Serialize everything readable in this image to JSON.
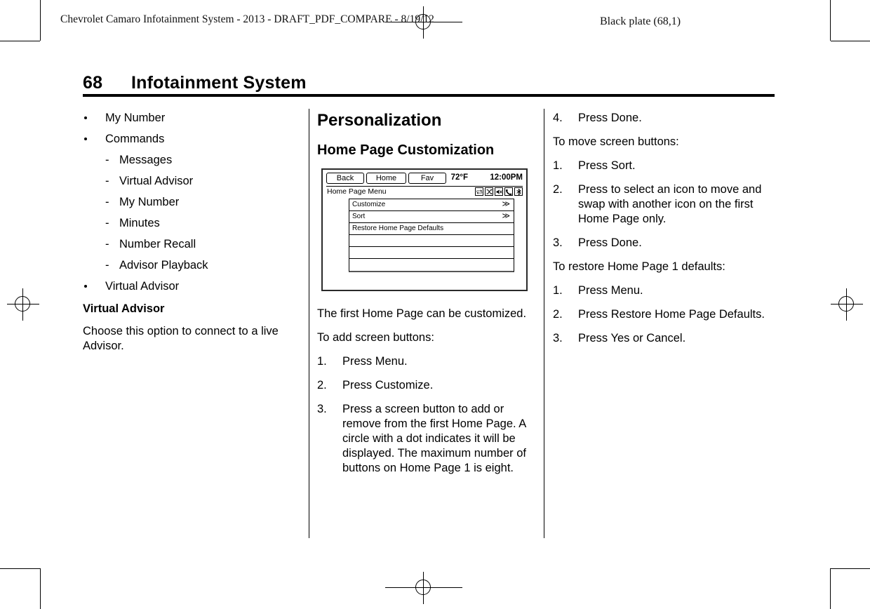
{
  "running_head": {
    "left": "Chevrolet Camaro Infotainment System - 2013 - DRAFT_PDF_COMPARE - 8/19/12",
    "right": "Black plate (68,1)"
  },
  "page_title": {
    "number": "68",
    "text": "Infotainment System"
  },
  "left_column": {
    "bullets": [
      {
        "label": "My Number",
        "sub": []
      },
      {
        "label": "Commands",
        "sub": [
          "Messages",
          "Virtual Advisor",
          "My Number",
          "Minutes",
          "Number Recall",
          "Advisor Playback"
        ]
      },
      {
        "label": "Virtual Advisor",
        "sub": []
      }
    ],
    "heading": "Virtual Advisor",
    "paragraph": "Choose this option to connect to a live Advisor."
  },
  "middle_column": {
    "section_heading": "Personalization",
    "sub_heading": "Home Page Customization",
    "screen": {
      "buttons": [
        {
          "label": "Back"
        },
        {
          "label": "Home"
        },
        {
          "label": "Fav"
        }
      ],
      "temperature": "72°F",
      "time": "12:00PM",
      "menu_title": "Home Page Menu",
      "status_icons": [
        "repeat-icon",
        "shuffle-icon",
        "mute-speaker-icon",
        "phone-icon",
        "bluetooth-icon"
      ],
      "rows": [
        {
          "label": "Customize",
          "arrow": "≫"
        },
        {
          "label": "Sort",
          "arrow": "≫"
        },
        {
          "label": "Restore Home Page Defaults",
          "arrow": ""
        },
        {
          "label": "",
          "arrow": ""
        },
        {
          "label": "",
          "arrow": ""
        },
        {
          "label": "",
          "arrow": ""
        }
      ]
    },
    "paragraph_1": "The first Home Page can be customized.",
    "paragraph_2": "To add screen buttons:",
    "steps": [
      {
        "num": "1.",
        "text": "Press Menu."
      },
      {
        "num": "2.",
        "text": "Press Customize."
      },
      {
        "num": "3.",
        "text": "Press a screen button to add or remove from the first Home Page. A circle with a dot indicates it will be displayed. The maximum number of buttons on Home Page 1 is eight."
      }
    ]
  },
  "right_column": {
    "steps_continued": [
      {
        "num": "4.",
        "text": "Press Done."
      }
    ],
    "move_intro": "To move screen buttons:",
    "move_steps": [
      {
        "num": "1.",
        "text": "Press Sort."
      },
      {
        "num": "2.",
        "text": "Press to select an icon to move and swap with another icon on the first Home Page only."
      },
      {
        "num": "3.",
        "text": "Press Done."
      }
    ],
    "restore_intro": "To restore Home Page 1 defaults:",
    "restore_steps": [
      {
        "num": "1.",
        "text": "Press Menu."
      },
      {
        "num": "2.",
        "text": "Press Restore Home Page Defaults."
      },
      {
        "num": "3.",
        "text": "Press Yes or Cancel."
      }
    ]
  },
  "colors": {
    "ink": "#000000",
    "paper": "#ffffff",
    "figure_frame": "#2a2a2a"
  }
}
